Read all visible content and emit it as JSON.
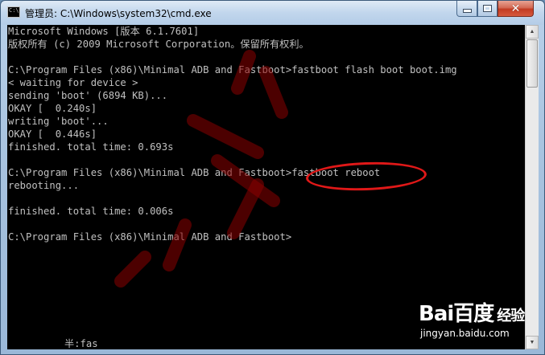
{
  "window": {
    "title": "管理员: C:\\Windows\\system32\\cmd.exe",
    "icon_label": "C:\\",
    "controls": {
      "minimize": "minimize-icon",
      "maximize": "maximize-icon",
      "close": "✕"
    }
  },
  "console": {
    "lines": [
      "Microsoft Windows [版本 6.1.7601]",
      "版权所有 (c) 2009 Microsoft Corporation。保留所有权利。",
      "",
      "C:\\Program Files (x86)\\Minimal ADB and Fastboot>fastboot flash boot boot.img",
      "< waiting for device >",
      "sending 'boot' (6894 KB)...",
      "OKAY [  0.240s]",
      "writing 'boot'...",
      "OKAY [  0.446s]",
      "finished. total time: 0.693s",
      "",
      "C:\\Program Files (x86)\\Minimal ADB and Fastboot>fastboot reboot",
      "rebooting...",
      "",
      "finished. total time: 0.006s",
      "",
      "C:\\Program Files (x86)\\Minimal ADB and Fastboot>"
    ],
    "ime_status": "半:fas"
  },
  "watermark": {
    "brand_logo": "Bai百度",
    "brand_subtitle": "经验",
    "brand_url": "jingyan.baidu.com"
  },
  "colors": {
    "console_bg": "#000000",
    "console_fg": "#c0c0c0",
    "annotation": "#e01818",
    "close_button": "#c23b22"
  }
}
